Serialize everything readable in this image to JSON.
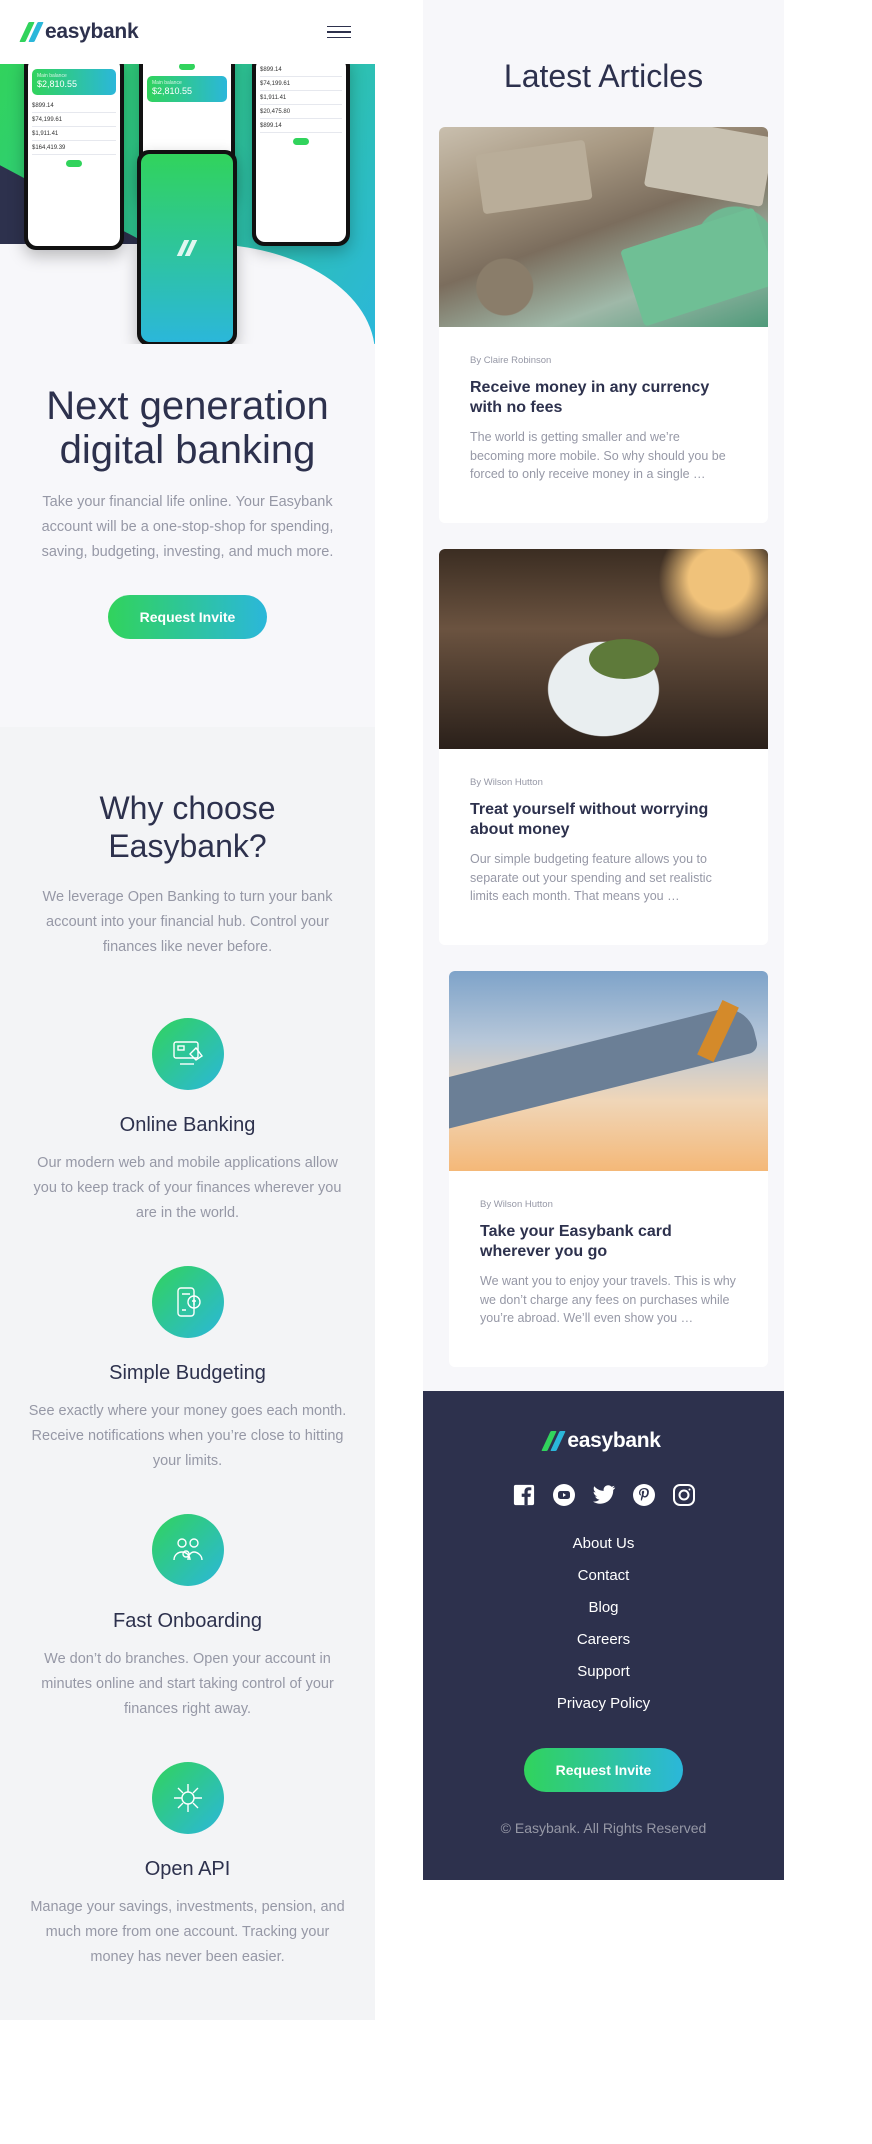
{
  "brand": {
    "name": "easybank",
    "accent_green": "#31d35c",
    "accent_cyan": "#2bb7da",
    "dark": "#2d314d"
  },
  "header": {
    "menu_icon": "hamburger-icon"
  },
  "hero": {
    "title": "Next generation digital banking",
    "description": "Take your financial life online. Your Easybank account will be a one-stop-shop for spending, saving, budgeting, investing, and much more.",
    "cta": "Request Invite",
    "phones": {
      "left_balance": "$2,810.55",
      "left_rows": [
        "$899.14",
        "$74,199.61",
        "$1,911.41",
        "$164,419.39"
      ],
      "middle_balance": "$2,810.55",
      "right_rows": [
        "$899.14",
        "$74,199.61",
        "$1,911.41",
        "$20,475.80",
        "$899.14"
      ]
    }
  },
  "why": {
    "title": "Why choose Easybank?",
    "description": "We leverage Open Banking to turn your bank account into your financial hub. Control your finances like never before.",
    "features": [
      {
        "icon": "online-banking-icon",
        "title": "Online Banking",
        "description": "Our modern web and mobile applications allow you to keep track of your finances wherever you are in the world."
      },
      {
        "icon": "budgeting-icon",
        "title": "Simple Budgeting",
        "description": "See exactly where your money goes each month. Receive notifications when you’re close to hitting your limits."
      },
      {
        "icon": "onboarding-icon",
        "title": "Fast Onboarding",
        "description": "We don’t do branches. Open your account in minutes online and start taking control of your finances right away."
      },
      {
        "icon": "api-icon",
        "title": "Open API",
        "description": "Manage your savings, investments, pension, and much more from one account. Tracking your money has never been easier."
      }
    ]
  },
  "articles": {
    "title": "Latest Articles",
    "items": [
      {
        "author": "By Claire Robinson",
        "title": "Receive money in any currency with no fees",
        "excerpt": "The world is getting smaller and we’re becoming more mobile. So why should you be forced to only receive money in a single …",
        "image": "currency-photo"
      },
      {
        "author": "By Wilson Hutton",
        "title": "Treat yourself without worrying about money",
        "excerpt": "Our simple budgeting feature allows you to separate out your spending and set realistic limits each month. That means you …",
        "image": "restaurant-photo"
      },
      {
        "author": "By Wilson Hutton",
        "title": "Take your Easybank card wherever you go",
        "excerpt": "We want you to enjoy your travels. This is why we don’t charge any fees on purchases while you’re abroad. We’ll even show you …",
        "image": "airplane-photo"
      }
    ]
  },
  "footer": {
    "socials": [
      "facebook-icon",
      "youtube-icon",
      "twitter-icon",
      "pinterest-icon",
      "instagram-icon"
    ],
    "links": [
      "About Us",
      "Contact",
      "Blog",
      "Careers",
      "Support",
      "Privacy Policy"
    ],
    "cta": "Request Invite",
    "copyright": "© Easybank. All Rights Reserved"
  }
}
